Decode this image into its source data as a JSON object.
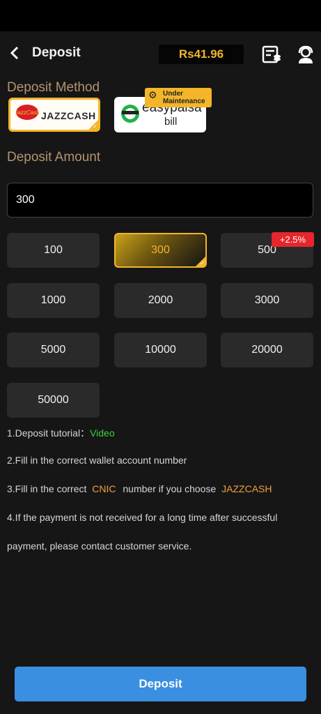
{
  "header": {
    "title": "Deposit",
    "balance": "Rs41.96"
  },
  "method": {
    "label": "Deposit Method",
    "options": [
      {
        "name": "JAZZCASH",
        "logo_text": "JazzCash",
        "selected": true
      },
      {
        "name_line1": "easypaisa",
        "name_line2": "bill",
        "badge_line1": "Under",
        "badge_line2": "Maintenance",
        "selected": false
      }
    ]
  },
  "amount": {
    "label": "Deposit Amount",
    "input_value": "300",
    "chips": [
      "100",
      "300",
      "500",
      "1000",
      "2000",
      "3000",
      "5000",
      "10000",
      "20000",
      "50000"
    ],
    "selected": "300",
    "bonus": "+2.5%"
  },
  "info": {
    "line1_prefix": "1.Deposit tutorial：",
    "line1_link": "Video",
    "line2": "2.Fill in the correct wallet account number",
    "line3_a": "3.Fill in the correct",
    "line3_cnic": "CNIC",
    "line3_b": "number if you choose",
    "line3_jazz": "JAZZCASH",
    "line4": "4.If the payment is not received for a long time after successful",
    "line5": "payment, please contact customer service."
  },
  "footer": {
    "deposit_label": "Deposit"
  },
  "colors": {
    "accent": "#f4b52a",
    "button": "#3a8fe0",
    "bonus": "#e5262c",
    "link": "#3fcf3a"
  }
}
